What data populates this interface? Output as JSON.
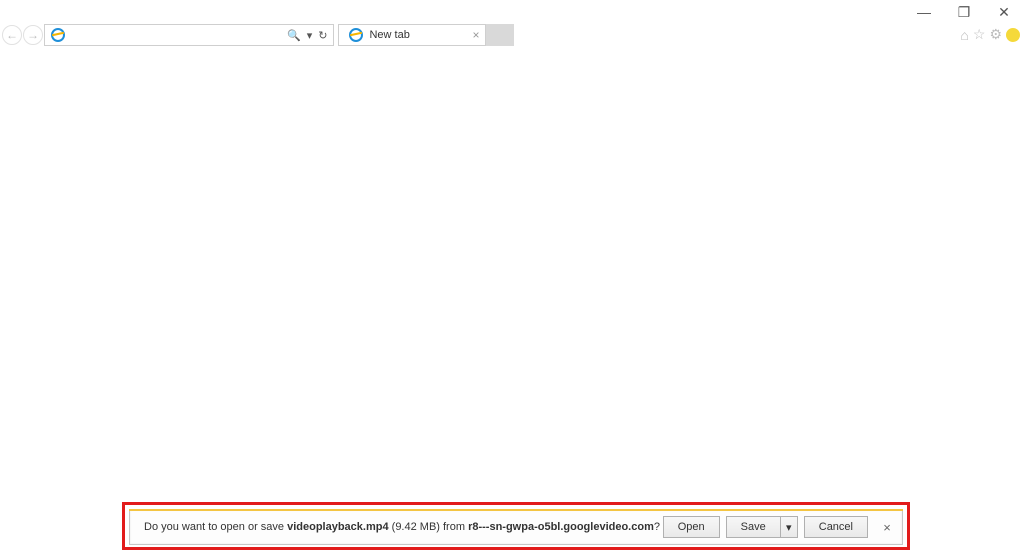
{
  "window_controls": {
    "minimize": "—",
    "restore": "❐",
    "close": "✕"
  },
  "nav": {
    "back": "←",
    "forward": "→",
    "search_glyph": "🔍",
    "dropdown_glyph": "▾",
    "refresh_glyph": "↻",
    "address_value": ""
  },
  "tab": {
    "label": "New tab",
    "close_glyph": "×"
  },
  "chrome": {
    "home_glyph": "⌂",
    "star_glyph": "☆",
    "gear_glyph": "⚙",
    "smiley": "🙂"
  },
  "download": {
    "prefix": "Do you want to open or save ",
    "filename": "videoplayback.mp4",
    "size": " (9.42 MB) ",
    "from_word": "from ",
    "host": "r8---sn-gwpa-o5bl.googlevideo.com",
    "suffix": "?",
    "open_label": "Open",
    "save_label": "Save",
    "save_caret": "▾",
    "cancel_label": "Cancel",
    "close_glyph": "×"
  }
}
